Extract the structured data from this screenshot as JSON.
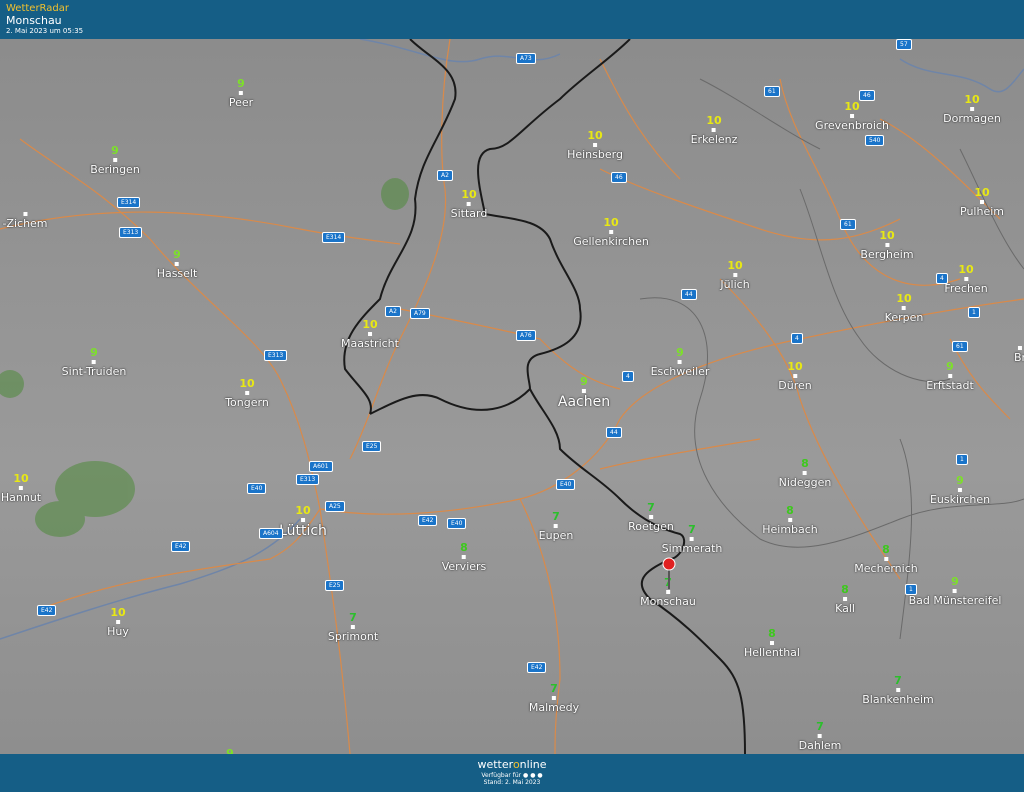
{
  "header": {
    "brand": "WetterRadar",
    "location": "Monschau",
    "timestamp": "2. Mai 2023 um 05:35"
  },
  "footer": {
    "logo_prefix": "wetter",
    "logo_o": "o",
    "logo_suffix": "nline",
    "available": "Verfügbar für",
    "platform_icons": [
      "android-icon",
      "apple-icon",
      "windows-icon"
    ],
    "stand": "Stand: 2. Mai 2023"
  },
  "colors": {
    "header_bg": "#155e86",
    "brand_yellow": "#f2c12e",
    "val_10": "#e8e814",
    "val_9": "#7de02a",
    "val_8": "#3ec81e",
    "val_7": "#2bbf2b",
    "road": "#d98a4a",
    "border": "#1a1a1a"
  },
  "cities": [
    {
      "name": "Peer",
      "value": "9"
    },
    {
      "name": "Beringen",
      "value": "9"
    },
    {
      "name": "-Zichem",
      "value": ""
    },
    {
      "name": "Hasselt",
      "value": "9"
    },
    {
      "name": "Sint-Truiden",
      "value": "9"
    },
    {
      "name": "Tongern",
      "value": "10"
    },
    {
      "name": "Hannut",
      "value": "10"
    },
    {
      "name": "Lüttich",
      "value": "10"
    },
    {
      "name": "Huy",
      "value": "10"
    },
    {
      "name": "Sprimont",
      "value": "7"
    },
    {
      "name": "Verviers",
      "value": "8"
    },
    {
      "name": "Eupen",
      "value": "7"
    },
    {
      "name": "Malmedy",
      "value": "7"
    },
    {
      "name": "Maastricht",
      "value": "10"
    },
    {
      "name": "Sittard",
      "value": "10"
    },
    {
      "name": "Heinsberg",
      "value": "10"
    },
    {
      "name": "Erkelenz",
      "value": "10"
    },
    {
      "name": "Grevenbroich",
      "value": "10"
    },
    {
      "name": "Dormagen",
      "value": "10"
    },
    {
      "name": "Gellenkirchen",
      "value": "10"
    },
    {
      "name": "Jülich",
      "value": "10"
    },
    {
      "name": "Bergheim",
      "value": "10"
    },
    {
      "name": "Pulheim",
      "value": "10"
    },
    {
      "name": "Frechen",
      "value": "10"
    },
    {
      "name": "Kerpen",
      "value": "10"
    },
    {
      "name": "Aachen",
      "value": "9"
    },
    {
      "name": "Eschweiler",
      "value": "9"
    },
    {
      "name": "Düren",
      "value": "10"
    },
    {
      "name": "Erftstadt",
      "value": "9"
    },
    {
      "name": "Nideggen",
      "value": "8"
    },
    {
      "name": "Roetgen",
      "value": "7"
    },
    {
      "name": "Simmerath",
      "value": "7"
    },
    {
      "name": "Heimbach",
      "value": "8"
    },
    {
      "name": "Euskirchen",
      "value": "9"
    },
    {
      "name": "Monschau",
      "value": "7"
    },
    {
      "name": "Mechernich",
      "value": "8"
    },
    {
      "name": "Kall",
      "value": "8"
    },
    {
      "name": "Bad Münstereifel",
      "value": "9"
    },
    {
      "name": "Hellenthal",
      "value": "8"
    },
    {
      "name": "Blankenheim",
      "value": "7"
    },
    {
      "name": "Dahlem",
      "value": "7"
    },
    {
      "name": "Br",
      "value": ""
    },
    {
      "name": "",
      "value": "9"
    }
  ],
  "road_shields": [
    "A73",
    "A2",
    "A2",
    "A79",
    "A76",
    "E314",
    "E313",
    "E314",
    "E313",
    "E25",
    "A601",
    "E313",
    "E40",
    "A25",
    "A604",
    "E42",
    "E25",
    "E42",
    "E40",
    "E42",
    "E40",
    "E42",
    "46",
    "44",
    "4",
    "44",
    "61",
    "46",
    "540",
    "61",
    "4",
    "1",
    "61",
    "4",
    "1",
    "1",
    "57"
  ]
}
